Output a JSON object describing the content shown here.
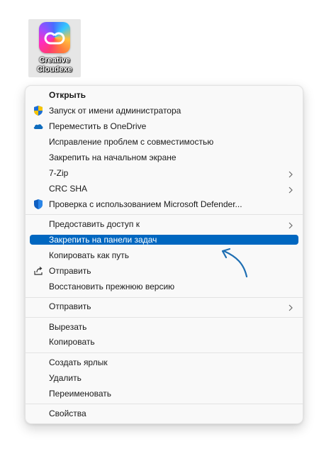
{
  "desktop_icon": {
    "label": "Creative\nCloudexe",
    "icon": "creative-cloud-logo"
  },
  "menu": {
    "items": [
      {
        "label": "Открыть",
        "bold": true
      },
      {
        "label": "Запуск от имени администратора",
        "icon": "uac-shield-icon"
      },
      {
        "label": "Переместить в OneDrive",
        "icon": "onedrive-cloud-icon"
      },
      {
        "label": "Исправление проблем с совместимостью"
      },
      {
        "label": "Закрепить на начальном экране"
      },
      {
        "label": "7-Zip",
        "submenu": true
      },
      {
        "label": "CRC SHA",
        "submenu": true
      },
      {
        "label": "Проверка с использованием Microsoft Defender...",
        "icon": "defender-shield-icon"
      },
      {
        "label": "Предоставить доступ к",
        "submenu": true
      },
      {
        "label": "Закрепить на панели задач",
        "highlighted": true
      },
      {
        "label": "Копировать как путь"
      },
      {
        "label": "Отправить",
        "icon": "share-icon"
      },
      {
        "label": "Восстановить прежнюю версию"
      },
      {
        "label": "Отправить",
        "submenu": true
      },
      {
        "label": "Вырезать"
      },
      {
        "label": "Копировать"
      },
      {
        "label": "Создать ярлык"
      },
      {
        "label": "Удалить"
      },
      {
        "label": "Переименовать"
      },
      {
        "label": "Свойства"
      }
    ]
  },
  "colors": {
    "highlight": "#0067c0",
    "annotation_arrow": "#1f6fb3"
  }
}
